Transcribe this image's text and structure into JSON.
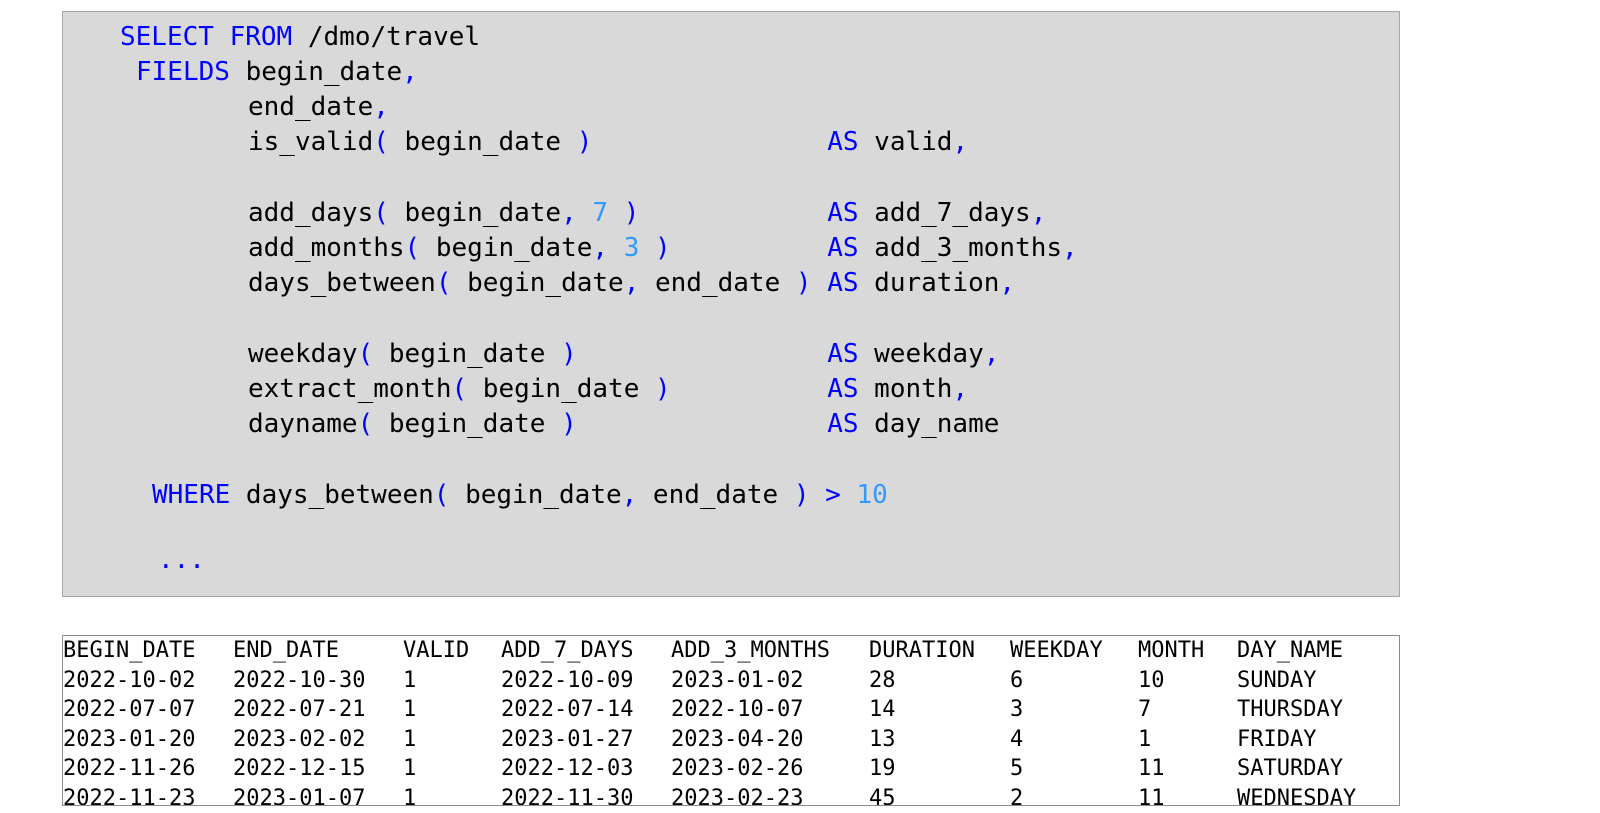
{
  "code": {
    "lines": [
      [
        {
          "t": "SELECT FROM ",
          "c": "kw_split"
        }
      ],
      [],
      [],
      [],
      [],
      [],
      [],
      [],
      [],
      [],
      [],
      [],
      [],
      [],
      [],
      []
    ],
    "segments": [
      [
        {
          "t": "SELECT",
          "k": "kw"
        },
        {
          "t": " ",
          "k": "tx"
        },
        {
          "t": "FROM",
          "k": "kw"
        },
        {
          "t": " /dmo/travel",
          "k": "tx"
        }
      ],
      [
        {
          "t": "FIELDS",
          "k": "kw"
        },
        {
          "t": " begin_date",
          "k": "tx"
        },
        {
          "t": ",",
          "k": "pn"
        }
      ],
      [
        {
          "t": "end_date",
          "k": "tx"
        },
        {
          "t": ",",
          "k": "pn"
        }
      ],
      [
        {
          "t": "is_valid",
          "k": "tx"
        },
        {
          "t": "(",
          "k": "pn"
        },
        {
          "t": " begin_date ",
          "k": "tx"
        },
        {
          "t": ")",
          "k": "pn"
        },
        {
          "t": "               ",
          "k": "tx"
        },
        {
          "t": "AS",
          "k": "kw"
        },
        {
          "t": " valid",
          "k": "tx"
        },
        {
          "t": ",",
          "k": "pn"
        }
      ],
      [],
      [
        {
          "t": "add_days",
          "k": "tx"
        },
        {
          "t": "(",
          "k": "pn"
        },
        {
          "t": " begin_date",
          "k": "tx"
        },
        {
          "t": ",",
          "k": "pn"
        },
        {
          "t": " ",
          "k": "tx"
        },
        {
          "t": "7",
          "k": "num"
        },
        {
          "t": " ",
          "k": "tx"
        },
        {
          "t": ")",
          "k": "pn"
        },
        {
          "t": "            ",
          "k": "tx"
        },
        {
          "t": "AS",
          "k": "kw"
        },
        {
          "t": " add_7_days",
          "k": "tx"
        },
        {
          "t": ",",
          "k": "pn"
        }
      ],
      [
        {
          "t": "add_months",
          "k": "tx"
        },
        {
          "t": "(",
          "k": "pn"
        },
        {
          "t": " begin_date",
          "k": "tx"
        },
        {
          "t": ",",
          "k": "pn"
        },
        {
          "t": " ",
          "k": "tx"
        },
        {
          "t": "3",
          "k": "num"
        },
        {
          "t": " ",
          "k": "tx"
        },
        {
          "t": ")",
          "k": "pn"
        },
        {
          "t": "          ",
          "k": "tx"
        },
        {
          "t": "AS",
          "k": "kw"
        },
        {
          "t": " add_3_months",
          "k": "tx"
        },
        {
          "t": ",",
          "k": "pn"
        }
      ],
      [
        {
          "t": "days_between",
          "k": "tx"
        },
        {
          "t": "(",
          "k": "pn"
        },
        {
          "t": " begin_date",
          "k": "tx"
        },
        {
          "t": ",",
          "k": "pn"
        },
        {
          "t": " end_date ",
          "k": "tx"
        },
        {
          "t": ")",
          "k": "pn"
        },
        {
          "t": " ",
          "k": "tx"
        },
        {
          "t": "AS",
          "k": "kw"
        },
        {
          "t": " duration",
          "k": "tx"
        },
        {
          "t": ",",
          "k": "pn"
        }
      ],
      [],
      [
        {
          "t": "weekday",
          "k": "tx"
        },
        {
          "t": "(",
          "k": "pn"
        },
        {
          "t": " begin_date ",
          "k": "tx"
        },
        {
          "t": ")",
          "k": "pn"
        },
        {
          "t": "                ",
          "k": "tx"
        },
        {
          "t": "AS",
          "k": "kw"
        },
        {
          "t": " weekday",
          "k": "tx"
        },
        {
          "t": ",",
          "k": "pn"
        }
      ],
      [
        {
          "t": "extract_month",
          "k": "tx"
        },
        {
          "t": "(",
          "k": "pn"
        },
        {
          "t": " begin_date ",
          "k": "tx"
        },
        {
          "t": ")",
          "k": "pn"
        },
        {
          "t": "          ",
          "k": "tx"
        },
        {
          "t": "AS",
          "k": "kw"
        },
        {
          "t": " month",
          "k": "tx"
        },
        {
          "t": ",",
          "k": "pn"
        }
      ],
      [
        {
          "t": "dayname",
          "k": "tx"
        },
        {
          "t": "(",
          "k": "pn"
        },
        {
          "t": " begin_date ",
          "k": "tx"
        },
        {
          "t": ")",
          "k": "pn"
        },
        {
          "t": "                ",
          "k": "tx"
        },
        {
          "t": "AS",
          "k": "kw"
        },
        {
          "t": " day_name",
          "k": "tx"
        }
      ],
      [],
      [
        {
          "t": "WHERE",
          "k": "kw"
        },
        {
          "t": " days_between",
          "k": "tx"
        },
        {
          "t": "(",
          "k": "pn"
        },
        {
          "t": " begin_date",
          "k": "tx"
        },
        {
          "t": ",",
          "k": "pn"
        },
        {
          "t": " end_date ",
          "k": "tx"
        },
        {
          "t": ")",
          "k": "pn"
        },
        {
          "t": " ",
          "k": "tx"
        },
        {
          "t": ">",
          "k": "pn"
        },
        {
          "t": " ",
          "k": "tx"
        },
        {
          "t": "10",
          "k": "num"
        }
      ],
      [],
      [
        {
          "t": "...",
          "k": "pn"
        }
      ]
    ]
  },
  "colors": {
    "keyword": "#0000ff",
    "number": "#3399ff",
    "code_background": "#d9d9d9"
  },
  "result": {
    "columns": [
      "BEGIN_DATE",
      "END_DATE",
      "VALID",
      "ADD_7_DAYS",
      "ADD_3_MONTHS",
      "DURATION",
      "WEEKDAY",
      "MONTH",
      "DAY_NAME"
    ],
    "rows": [
      [
        "2022-10-02",
        "2022-10-30",
        "1",
        "2022-10-09",
        "2023-01-02",
        "28",
        "6",
        "10",
        "SUNDAY"
      ],
      [
        "2022-07-07",
        "2022-07-21",
        "1",
        "2022-07-14",
        "2022-10-07",
        "14",
        "3",
        "7",
        "THURSDAY"
      ],
      [
        "2023-01-20",
        "2023-02-02",
        "1",
        "2023-01-27",
        "2023-04-20",
        "13",
        "4",
        "1",
        "FRIDAY"
      ],
      [
        "2022-11-26",
        "2022-12-15",
        "1",
        "2022-12-03",
        "2023-02-26",
        "19",
        "5",
        "11",
        "SATURDAY"
      ],
      [
        "2022-11-23",
        "2023-01-07",
        "1",
        "2022-11-30",
        "2023-02-23",
        "45",
        "2",
        "11",
        "WEDNESDAY"
      ]
    ]
  }
}
